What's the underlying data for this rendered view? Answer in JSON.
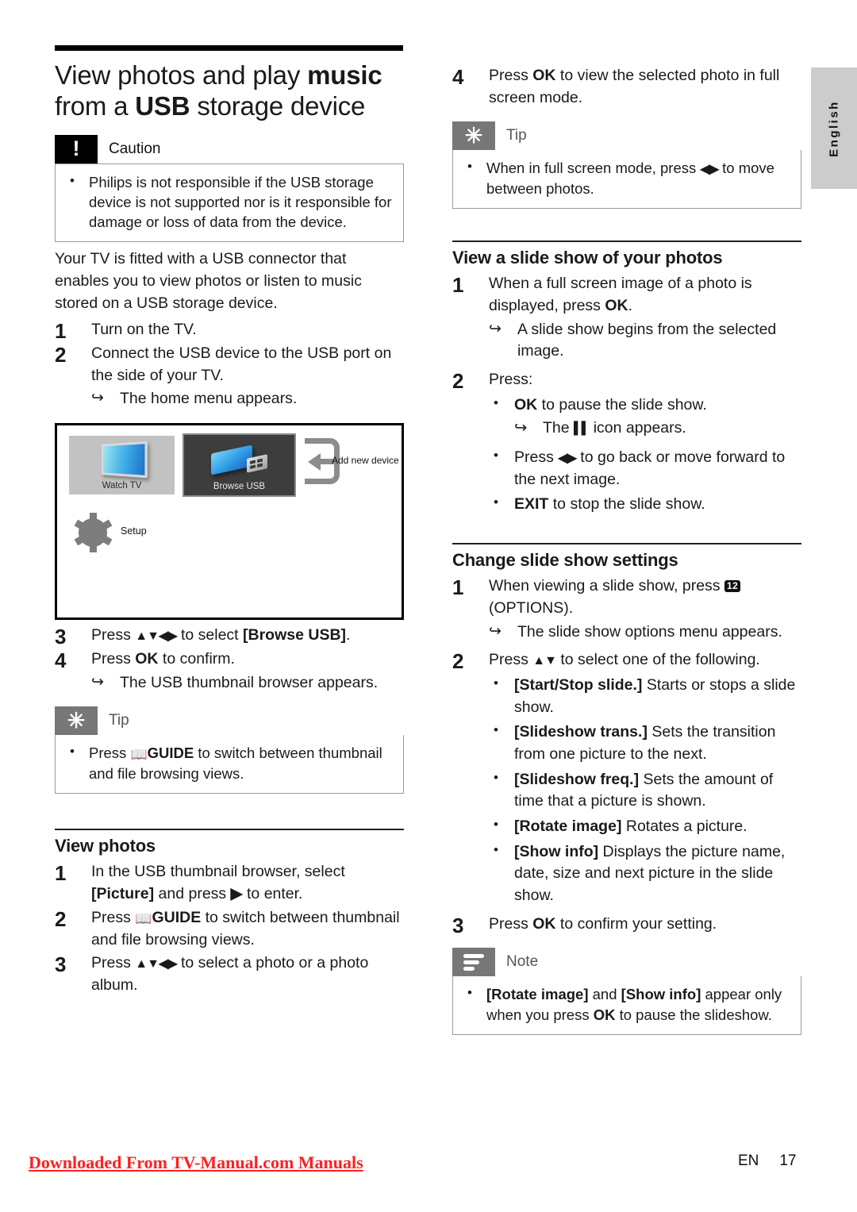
{
  "sidebar_tab": {
    "label": "English"
  },
  "title": {
    "line1_a": "View photos and play ",
    "line1_b": "music",
    "line2_a": "from a ",
    "line2_b": "USB",
    "line2_c": " storage device"
  },
  "caution": {
    "label": "Caution",
    "icon": "exclamation-icon",
    "bullets": [
      "Philips is not responsible if the USB storage device is not supported nor is it responsible for damage or loss of data from the device."
    ]
  },
  "intro": "Your TV is fitted with a USB connector that enables you to view photos or listen to music stored on a USB storage device.",
  "usb_steps": {
    "step1_num": "1",
    "step1_text": "Turn on the TV.",
    "step2_num": "2",
    "step2_text": "Connect the USB device to the USB port on the side of your TV.",
    "step2_result": "The home menu appears.",
    "step3_num": "3",
    "step3_pre": "Press ",
    "step3_keys": "▲▼◀▶",
    "step3_mid": " to select ",
    "step3_target": "[Browse USB]",
    "step3_post": ".",
    "step4_num": "4",
    "step4_pre": "Press ",
    "step4_key": "OK",
    "step4_post": " to confirm.",
    "step4_result": "The USB thumbnail browser appears."
  },
  "tv_menu": {
    "watch_tv": "Watch TV",
    "browse_usb": "Browse USB",
    "add_new_device": "Add new device",
    "setup": "Setup"
  },
  "tip_usb": {
    "label": "Tip",
    "icon": "asterisk-icon",
    "bullet_pre": "Press ",
    "bullet_guide": "GUIDE",
    "bullet_post": " to switch between thumbnail and file browsing views."
  },
  "view_photos": {
    "heading": "View photos",
    "step1_num": "1",
    "step1_pre": "In the USB thumbnail browser, select ",
    "step1_target": "[Picture]",
    "step1_mid": " and press ",
    "step1_key": "▶",
    "step1_post": " to enter.",
    "step2_num": "2",
    "step2_pre": "Press ",
    "step2_guide": "GUIDE",
    "step2_post": " to switch between thumbnail and file browsing views.",
    "step3_num": "3",
    "step3_pre": "Press ",
    "step3_keys": "▲▼◀▶",
    "step3_post": " to select a photo or a photo album."
  },
  "right_step4": {
    "num": "4",
    "pre": "Press ",
    "key": "OK",
    "post": " to view the selected photo in full screen mode."
  },
  "tip_fullscreen": {
    "label": "Tip",
    "icon": "asterisk-icon",
    "bullet_pre": "When in full screen mode, press ",
    "bullet_keys": "◀▶",
    "bullet_post": " to move between photos."
  },
  "slideshow": {
    "heading": "View a slide show of your photos",
    "step1_num": "1",
    "step1_pre": "When a full screen image of a photo is displayed, press ",
    "step1_key": "OK",
    "step1_post": ".",
    "step1_result": "A slide show begins from the selected image.",
    "step2_num": "2",
    "step2_text": "Press:",
    "b1_key": "OK",
    "b1_text": " to pause the slide show.",
    "b1_result_pre": "The ",
    "b1_result_icon": "▌▌",
    "b1_result_post": " icon appears.",
    "b2_pre": "Press ",
    "b2_keys": "◀▶",
    "b2_post": " to go back or move forward to the next image.",
    "b3_key": "EXIT",
    "b3_text": " to stop the slide show."
  },
  "settings": {
    "heading": "Change slide show settings",
    "step1_num": "1",
    "step1_pre": "When viewing a slide show, press ",
    "step1_icon": "12",
    "step1_post": "(OPTIONS).",
    "step1_result": "The slide show options menu appears.",
    "step2_num": "2",
    "step2_pre": "Press ",
    "step2_keys": "▲▼",
    "step2_post": " to select one of the following.",
    "options": [
      {
        "term": "[Start/Stop slide.]",
        "desc": " Starts or stops a slide show."
      },
      {
        "term": "[Slideshow trans.]",
        "desc": " Sets the transition from one picture to the next."
      },
      {
        "term": "[Slideshow freq.]",
        "desc": " Sets the amount of time that a picture is shown."
      },
      {
        "term": "[Rotate image]",
        "desc": " Rotates a picture."
      },
      {
        "term": "[Show info]",
        "desc": " Displays the picture name, date, size and next picture in the slide show."
      }
    ],
    "step3_num": "3",
    "step3_pre": "Press ",
    "step3_key": "OK",
    "step3_post": " to confirm your setting."
  },
  "note": {
    "label": "Note",
    "icon": "note-lines-icon",
    "b_term1": "[Rotate image]",
    "b_mid1": " and ",
    "b_term2": "[Show info]",
    "b_mid2": " appear only when you press ",
    "b_key": "OK",
    "b_post": " to pause the slideshow."
  },
  "footer": {
    "watermark": "Downloaded From TV-Manual.com Manuals",
    "lang": "EN",
    "page": "17"
  }
}
